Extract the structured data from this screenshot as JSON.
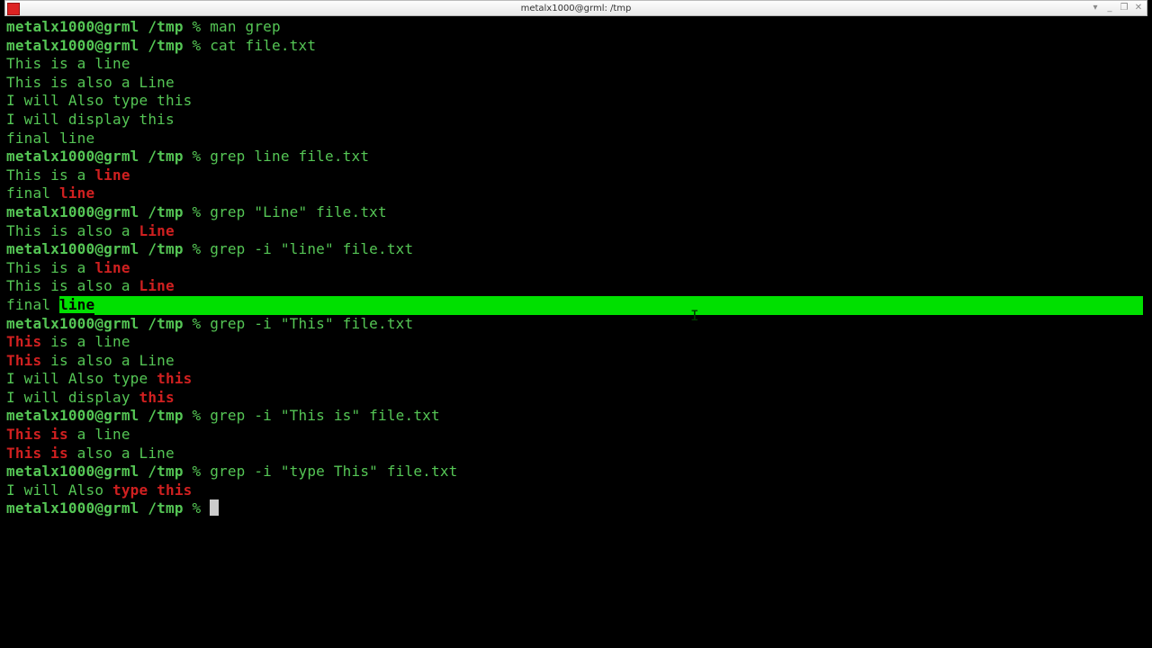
{
  "title": "metalx1000@grml: /tmp",
  "prompt": {
    "user": "metalx1000",
    "host": "grml",
    "path": "/tmp",
    "symbol": "%"
  },
  "session": [
    {
      "type": "cmd",
      "text": "man grep"
    },
    {
      "type": "cmd",
      "text": "cat file.txt"
    },
    {
      "type": "out",
      "parts": [
        [
          "plain",
          "This is a line"
        ]
      ]
    },
    {
      "type": "out",
      "parts": [
        [
          "plain",
          "This is also a Line"
        ]
      ]
    },
    {
      "type": "out",
      "parts": [
        [
          "plain",
          "I will Also type this"
        ]
      ]
    },
    {
      "type": "out",
      "parts": [
        [
          "plain",
          "I will display this"
        ]
      ]
    },
    {
      "type": "out",
      "parts": [
        [
          "plain",
          "final line"
        ]
      ]
    },
    {
      "type": "cmd",
      "text": "grep line file.txt"
    },
    {
      "type": "out",
      "parts": [
        [
          "plain",
          "This is a "
        ],
        [
          "match",
          "line"
        ]
      ]
    },
    {
      "type": "out",
      "parts": [
        [
          "plain",
          "final "
        ],
        [
          "match",
          "line"
        ]
      ]
    },
    {
      "type": "cmd",
      "text": "grep \"Line\" file.txt"
    },
    {
      "type": "out",
      "parts": [
        [
          "plain",
          "This is also a "
        ],
        [
          "match",
          "Line"
        ]
      ]
    },
    {
      "type": "cmd",
      "text": "grep -i \"line\" file.txt"
    },
    {
      "type": "out",
      "parts": [
        [
          "plain",
          "This is a "
        ],
        [
          "match",
          "line"
        ]
      ]
    },
    {
      "type": "out",
      "parts": [
        [
          "plain",
          "This is also a "
        ],
        [
          "match",
          "Line"
        ]
      ]
    },
    {
      "type": "out",
      "selected": true,
      "parts": [
        [
          "plain",
          "final "
        ],
        [
          "sel",
          "line"
        ]
      ]
    },
    {
      "type": "cmd",
      "text": "grep -i \"This\" file.txt"
    },
    {
      "type": "out",
      "parts": [
        [
          "match",
          "This"
        ],
        [
          "plain",
          " is a line"
        ]
      ]
    },
    {
      "type": "out",
      "parts": [
        [
          "match",
          "This"
        ],
        [
          "plain",
          " is also a Line"
        ]
      ]
    },
    {
      "type": "out",
      "parts": [
        [
          "plain",
          "I will Also type "
        ],
        [
          "match",
          "this"
        ]
      ]
    },
    {
      "type": "out",
      "parts": [
        [
          "plain",
          "I will display "
        ],
        [
          "match",
          "this"
        ]
      ]
    },
    {
      "type": "cmd",
      "text": "grep -i \"This is\" file.txt"
    },
    {
      "type": "out",
      "parts": [
        [
          "match",
          "This is"
        ],
        [
          "plain",
          " a line"
        ]
      ]
    },
    {
      "type": "out",
      "parts": [
        [
          "match",
          "This is"
        ],
        [
          "plain",
          " also a Line"
        ]
      ]
    },
    {
      "type": "cmd",
      "text": "grep -i \"type This\" file.txt"
    },
    {
      "type": "out",
      "parts": [
        [
          "plain",
          "I will Also "
        ],
        [
          "match",
          "type this"
        ]
      ]
    },
    {
      "type": "cmd",
      "text": "",
      "cursor": true
    }
  ],
  "window_controls": [
    "▾",
    "_",
    "❐",
    "✕"
  ]
}
